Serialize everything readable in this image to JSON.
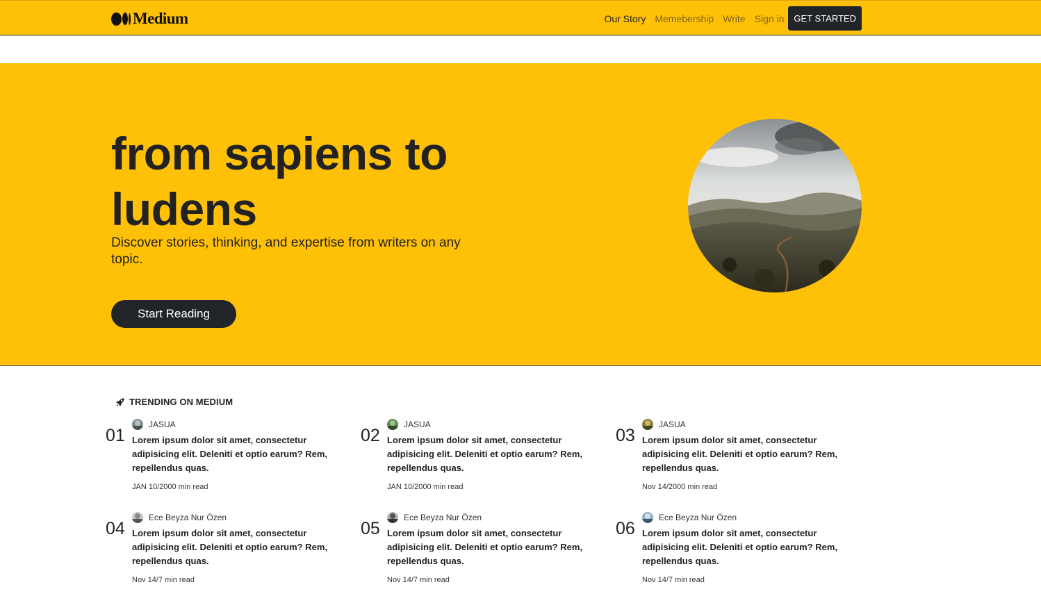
{
  "brand": {
    "name": "Medium"
  },
  "nav": {
    "links": [
      "Our Story",
      "Memebership",
      "Write",
      "Sign in"
    ],
    "cta": "GET STARTED"
  },
  "hero": {
    "title": "from sapiens to ludens",
    "subtitle": "Discover stories, thinking, and expertise from writers on any topic.",
    "button": "Start Reading"
  },
  "trending": {
    "heading": "TRENDING ON MEDIUM",
    "icon": "rocket-icon",
    "items": [
      {
        "num": "01",
        "author": "JASUA",
        "text": "Lorem ipsum dolor sit amet, consectetur adipisicing elit. Deleniti et optio earum? Rem, repellendus quas.",
        "meta": "JAN 10/2000 min read"
      },
      {
        "num": "02",
        "author": "JASUA",
        "text": "Lorem ipsum dolor sit amet, consectetur adipisicing elit. Deleniti et optio earum? Rem, repellendus quas.",
        "meta": "JAN 10/2000 min read"
      },
      {
        "num": "03",
        "author": "JASUA",
        "text": "Lorem ipsum dolor sit amet, consectetur adipisicing elit. Deleniti et optio earum? Rem, repellendus quas.",
        "meta": "Nov 14/2000 min read"
      },
      {
        "num": "04",
        "author": "Ece Beyza Nur Özen",
        "text": "Lorem ipsum dolor sit amet, consectetur adipisicing elit. Deleniti et optio earum? Rem, repellendus quas.",
        "meta": "Nov 14/7 min read"
      },
      {
        "num": "05",
        "author": "Ece Beyza Nur Özen",
        "text": "Lorem ipsum dolor sit amet, consectetur adipisicing elit. Deleniti et optio earum? Rem, repellendus quas.",
        "meta": "Nov 14/7 min read"
      },
      {
        "num": "06",
        "author": "Ece Beyza Nur Özen",
        "text": "Lorem ipsum dolor sit amet, consectetur adipisicing elit. Deleniti et optio earum? Rem, repellendus quas.",
        "meta": "Nov 14/7 min read"
      }
    ]
  },
  "colors": {
    "brand_yellow": "#ffc107",
    "dark": "#212529"
  }
}
